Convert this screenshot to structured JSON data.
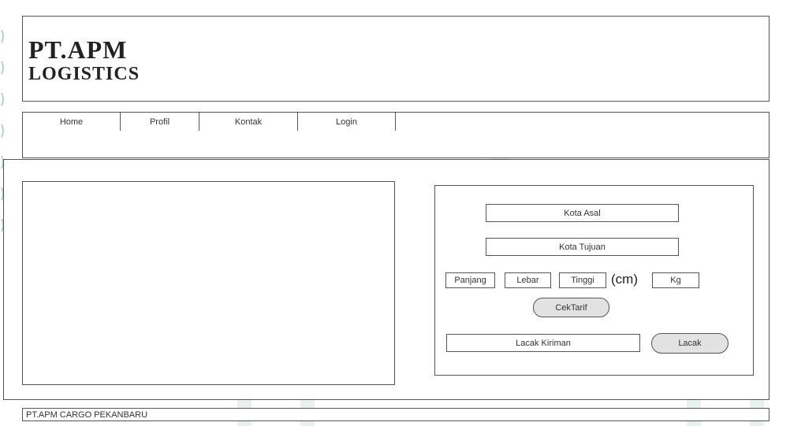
{
  "header": {
    "brand_line1": "PT.APM",
    "brand_line2": "LOGISTICS"
  },
  "nav": [
    {
      "label": "Home"
    },
    {
      "label": "Profil"
    },
    {
      "label": "Kontak"
    },
    {
      "label": "Login"
    }
  ],
  "form": {
    "kota_asal": "Kota Asal",
    "kota_tujuan": "Kota Tujuan",
    "panjang": "Panjang",
    "lebar": "Lebar",
    "tinggi": "Tinggi",
    "unit_cm": "(cm)",
    "kg": "Kg",
    "cek_tarif_button": "CekTarif",
    "lacak_kiriman": "Lacak Kiriman",
    "lacak_button": "Lacak"
  },
  "footer": {
    "text": "PT.APM CARGO PEKANBARU"
  },
  "colors": {
    "border": "#555555",
    "button_fill": "#e2e2e2",
    "watermark": "#2e8b57"
  }
}
